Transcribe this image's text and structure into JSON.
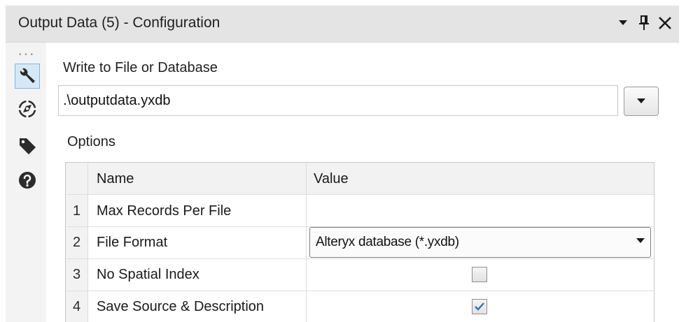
{
  "header": {
    "title": "Output Data (5) - Configuration",
    "icons": [
      "dropdown-arrow-icon",
      "pin-icon",
      "close-icon"
    ]
  },
  "sidebar": {
    "icons": [
      "wrench-icon",
      "compass-icon",
      "tag-icon",
      "help-icon"
    ],
    "active": "wrench-icon"
  },
  "main": {
    "write_label": "Write to File or Database",
    "file_path": ".\\outputdata.yxdb",
    "options_label": "Options"
  },
  "options_table": {
    "columns": [
      "Name",
      "Value"
    ],
    "rows": [
      {
        "num": "1",
        "name": "Max Records Per File",
        "value": ""
      },
      {
        "num": "2",
        "name": "File Format",
        "value": "Alteryx database (*.yxdb)"
      },
      {
        "num": "3",
        "name": "No Spatial Index",
        "value": "",
        "checked": false
      },
      {
        "num": "4",
        "name": "Save Source & Description",
        "value": "",
        "checked": true
      }
    ]
  },
  "colors": {
    "header_bg": "#e4e4e4",
    "active_icon_bg": "#d6e8f7",
    "check_color": "#3a6fb5"
  }
}
